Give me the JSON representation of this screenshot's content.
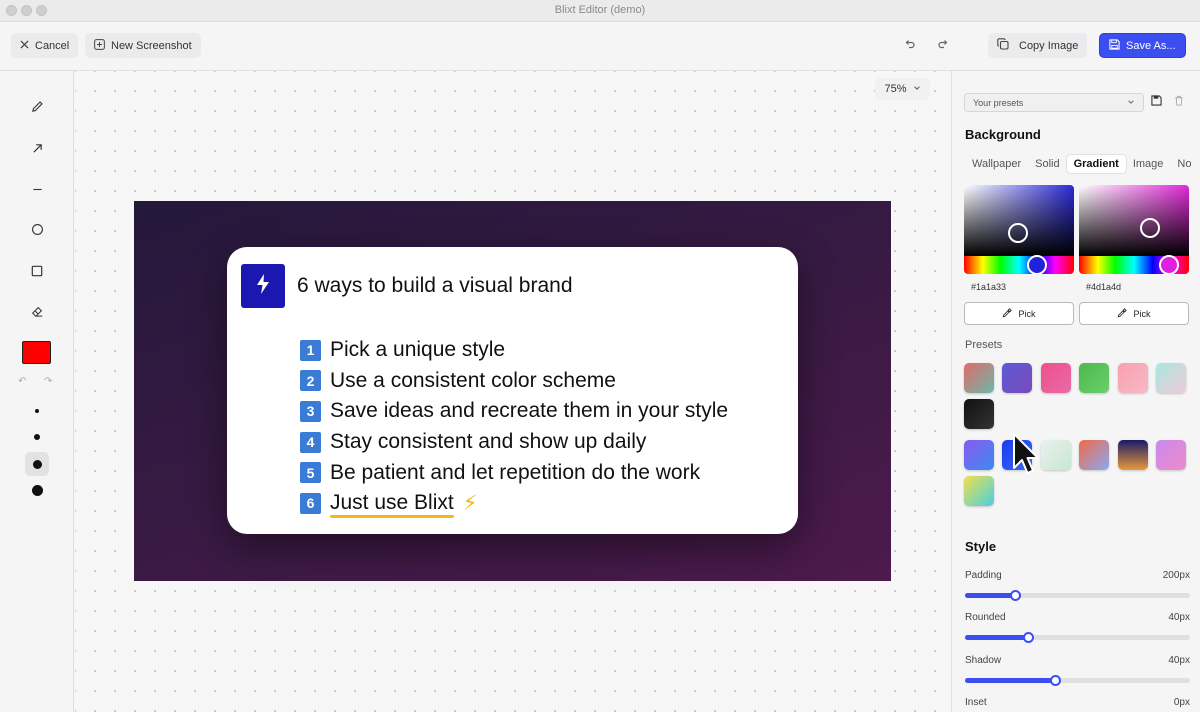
{
  "window": {
    "title": "Blixt Editor (demo)"
  },
  "toolbar": {
    "cancel_label": "Cancel",
    "new_screenshot_label": "New Screenshot",
    "copy_image_label": "Copy Image",
    "save_as_label": "Save As..."
  },
  "canvas": {
    "zoom": "75%",
    "card": {
      "title": "6 ways to build a visual brand",
      "items": [
        {
          "num": "1",
          "text": "Pick a unique style"
        },
        {
          "num": "2",
          "text": "Use a consistent color scheme"
        },
        {
          "num": "3",
          "text": "Save ideas and recreate them in your style"
        },
        {
          "num": "4",
          "text": "Stay consistent and show up daily"
        },
        {
          "num": "5",
          "text": "Be patient and let repetition do the work"
        },
        {
          "num": "6",
          "text": "Just use Blixt",
          "emoji": "⚡"
        }
      ]
    }
  },
  "tools": [
    "pencil-icon",
    "arrow-icon",
    "line-icon",
    "circle-icon",
    "square-icon",
    "eraser-icon"
  ],
  "panel": {
    "presets_select": "Your presets",
    "background_heading": "Background",
    "tabs": [
      "Wallpaper",
      "Solid",
      "Gradient",
      "Image",
      "No"
    ],
    "active_tab": "Gradient",
    "color1": "#1a1a33",
    "color2": "#4d1a4d",
    "pick_label": "Pick",
    "presets_label": "Presets",
    "style_heading": "Style",
    "sliders": [
      {
        "label": "Padding",
        "value": "200px",
        "level": 0.22
      },
      {
        "label": "Rounded",
        "value": "40px",
        "level": 0.28
      },
      {
        "label": "Shadow",
        "value": "40px",
        "level": 0.4
      },
      {
        "label": "Inset",
        "value": "0px",
        "level": 0
      }
    ]
  },
  "colors": {
    "accent": "#3b4ef0",
    "draw_color": "#ff0000"
  }
}
